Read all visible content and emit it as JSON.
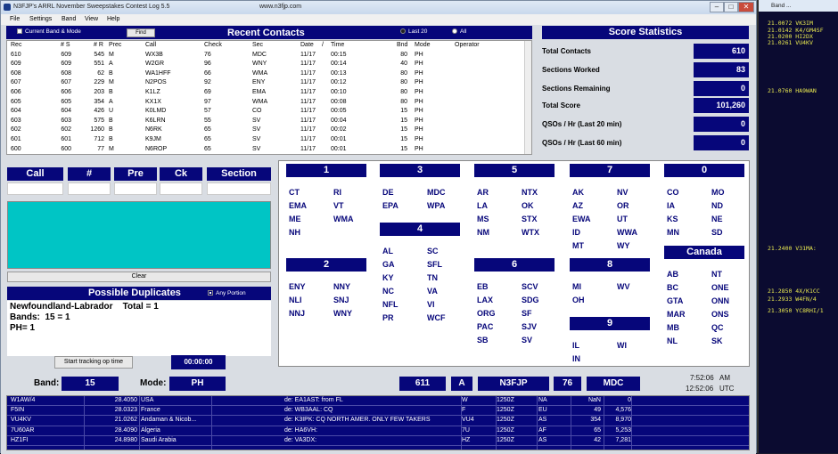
{
  "app": {
    "title": "N3FJP's ARRL November Sweepstakes Contest Log 5.5",
    "url": "www.n3fjp.com",
    "minimize": "–",
    "maximize": "□",
    "close": "✕"
  },
  "menu": [
    "File",
    "Settings",
    "Band",
    "View",
    "Help"
  ],
  "recent": {
    "title": "Recent Contacts",
    "current_band_mode": "Current Band & Mode",
    "find": "Find",
    "last20": "Last 20",
    "all": "All",
    "columns": [
      "Rec",
      "# S",
      "# R",
      "Prec",
      "Call",
      "Check",
      "Sec",
      "Date",
      "/",
      "Time",
      "Bnd",
      "Mode",
      "Operator"
    ],
    "rows": [
      [
        "610",
        "609",
        "545",
        "M",
        "WX3B",
        "76",
        "MDC",
        "11/17",
        "00:15",
        "80",
        "PH",
        ""
      ],
      [
        "609",
        "609",
        "551",
        "A",
        "W2GR",
        "96",
        "WNY",
        "11/17",
        "00:14",
        "40",
        "PH",
        ""
      ],
      [
        "608",
        "608",
        "62",
        "B",
        "WA1HFF",
        "66",
        "WMA",
        "11/17",
        "00:13",
        "80",
        "PH",
        ""
      ],
      [
        "607",
        "607",
        "229",
        "M",
        "N2POS",
        "92",
        "ENY",
        "11/17",
        "00:12",
        "80",
        "PH",
        ""
      ],
      [
        "606",
        "606",
        "203",
        "B",
        "K1LZ",
        "69",
        "EMA",
        "11/17",
        "00:10",
        "80",
        "PH",
        ""
      ],
      [
        "605",
        "605",
        "354",
        "A",
        "KX1X",
        "97",
        "WMA",
        "11/17",
        "00:08",
        "80",
        "PH",
        ""
      ],
      [
        "604",
        "604",
        "426",
        "U",
        "K0LMD",
        "57",
        "CO",
        "11/17",
        "00:05",
        "15",
        "PH",
        ""
      ],
      [
        "603",
        "603",
        "575",
        "B",
        "K6LRN",
        "55",
        "SV",
        "11/17",
        "00:04",
        "15",
        "PH",
        ""
      ],
      [
        "602",
        "602",
        "1260",
        "B",
        "N6RK",
        "65",
        "SV",
        "11/17",
        "00:02",
        "15",
        "PH",
        ""
      ],
      [
        "601",
        "601",
        "712",
        "B",
        "K9JM",
        "65",
        "SV",
        "11/17",
        "00:01",
        "15",
        "PH",
        ""
      ],
      [
        "600",
        "600",
        "77",
        "M",
        "N6ROP",
        "65",
        "SV",
        "11/17",
        "00:01",
        "15",
        "PH",
        ""
      ]
    ]
  },
  "score": {
    "title": "Score Statistics",
    "items": [
      {
        "label": "Total Contacts",
        "value": "610"
      },
      {
        "label": "Sections Worked",
        "value": "83"
      },
      {
        "label": "Sections Remaining",
        "value": "0"
      },
      {
        "label": "Total Score",
        "value": "101,260"
      },
      {
        "label": "QSOs / Hr (Last 20 min)",
        "value": "0"
      },
      {
        "label": "QSOs / Hr (Last 60 min)",
        "value": "0"
      }
    ]
  },
  "entry": {
    "call": "Call",
    "num": "#",
    "pre": "Pre",
    "ck": "Ck",
    "section": "Section",
    "clear": "Clear"
  },
  "dupes": {
    "title": "Possible Duplicates",
    "any_portion": "Any Portion",
    "line1": "Newfoundland-Labrador    Total = 1",
    "line2": "Bands:  15 = 1",
    "line3": "PH= 1"
  },
  "tracking": {
    "start": "Start tracking op time",
    "timer": "00:00:00"
  },
  "sections": {
    "groups": [
      {
        "name": "1",
        "items": [
          "CT",
          "RI",
          "EMA",
          "VT",
          "ME",
          "WMA",
          "NH"
        ]
      },
      {
        "name": "2",
        "items": [
          "ENY",
          "NNY",
          "NLI",
          "SNJ",
          "NNJ",
          "WNY"
        ]
      },
      {
        "name": "3",
        "items": [
          "DE",
          "MDC",
          "EPA",
          "WPA"
        ]
      },
      {
        "name": "4",
        "items": [
          "AL",
          "SC",
          "GA",
          "SFL",
          "KY",
          "TN",
          "NC",
          "VA",
          "NFL",
          "VI",
          "PR",
          "WCF"
        ]
      },
      {
        "name": "5",
        "items": [
          "AR",
          "NTX",
          "LA",
          "OK",
          "MS",
          "STX",
          "NM",
          "WTX"
        ]
      },
      {
        "name": "6",
        "items": [
          "EB",
          "SCV",
          "LAX",
          "SDG",
          "ORG",
          "SF",
          "PAC",
          "SJV",
          "SB",
          "SV"
        ]
      },
      {
        "name": "7",
        "items": [
          "AK",
          "NV",
          "AZ",
          "OR",
          "EWA",
          "UT",
          "ID",
          "WWA",
          "MT",
          "WY"
        ]
      },
      {
        "name": "8",
        "items": [
          "MI",
          "WV",
          "OH"
        ]
      },
      {
        "name": "9",
        "items": [
          "IL",
          "WI",
          "IN"
        ]
      },
      {
        "name": "0",
        "items": [
          "CO",
          "MO",
          "IA",
          "ND",
          "KS",
          "NE",
          "MN",
          "SD"
        ]
      },
      {
        "name": "Canada",
        "items": [
          "AB",
          "NT",
          "BC",
          "ONE",
          "GTA",
          "ONN",
          "MAR",
          "ONS",
          "MB",
          "QC",
          "NL",
          "SK"
        ]
      }
    ]
  },
  "status": {
    "band_label": "Band:",
    "band": "15",
    "mode_label": "Mode:",
    "mode": "PH",
    "next_num": "611",
    "prec": "A",
    "mycall": "N3FJP",
    "check": "76",
    "section": "MDC",
    "local_time": "7:52:06",
    "local_suffix": "AM",
    "utc_time": "12:52:06",
    "utc_suffix": "UTC"
  },
  "spots": {
    "rows": [
      [
        "W1AW/4",
        "28.4050",
        "USA",
        "de: EA1AST: from FL",
        "W",
        "1250Z",
        "NA",
        "NaN",
        "0"
      ],
      [
        "F5IN",
        "28.0323",
        "France",
        "de: WB3AAL: CQ",
        "F",
        "1250Z",
        "EU",
        "49",
        "4,576"
      ],
      [
        "VU4KV",
        "21.0262",
        "Andaman & Nicob...",
        "de: K3IPK: CQ NORTH AMER. ONLY FEW TAKERS",
        "VU4",
        "1250Z",
        "AS",
        "354",
        "8,970"
      ],
      [
        "7U60AR",
        "28.4090",
        "Algeria",
        "de: HA6VH:",
        "7U",
        "1250Z",
        "AF",
        "65",
        "5,253"
      ],
      [
        "HZ1FI",
        "24.8980",
        "Saudi Arabia",
        "de: VA3DX:",
        "HZ",
        "1250Z",
        "AS",
        "42",
        "7,281"
      ]
    ]
  },
  "sidepanel": {
    "title": "Band ...",
    "lines": [
      "21.0072  VK3IM",
      "21.0142  K4/GM4SF",
      "21.0200  HI2DX",
      "21.0261  VU4KV",
      "21.0760  HA9WAN",
      "21.2400  V31MA:",
      "21.2850  4X/K1CC",
      "21.2933  W4FN/4",
      "21.3050  YC8RHI/1"
    ]
  },
  "colors": {
    "accent": "#06067a",
    "entry_bg": "#00c5c5",
    "side_text": "#e8e850"
  }
}
